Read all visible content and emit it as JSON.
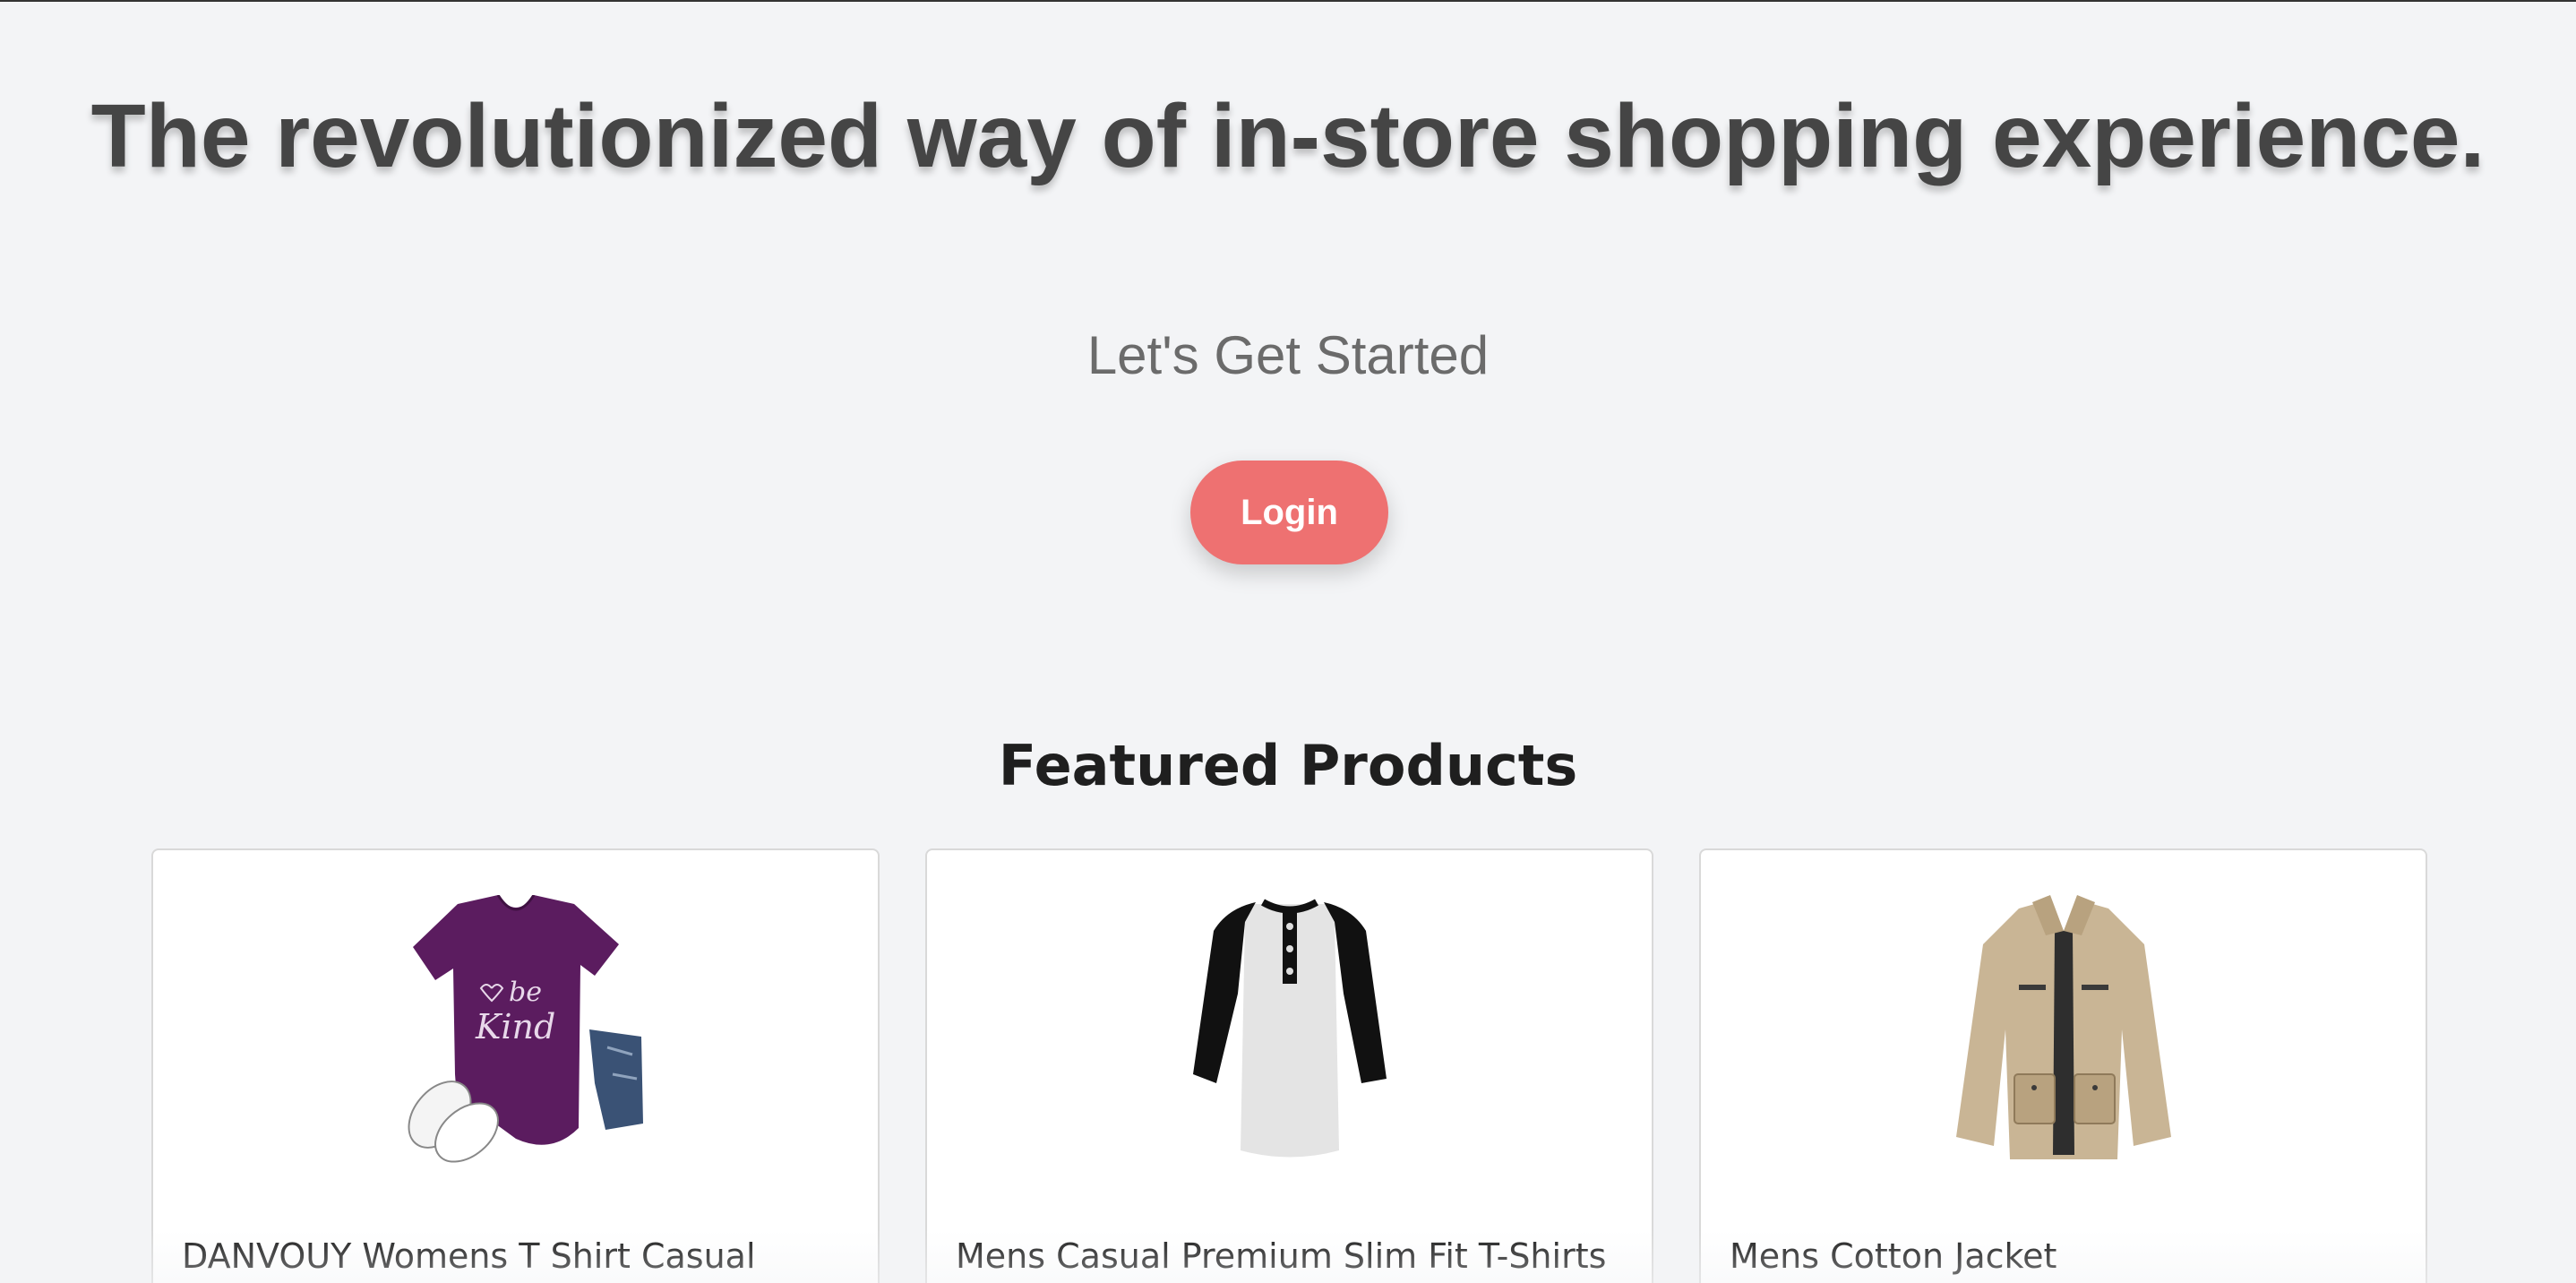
{
  "hero": {
    "title": "The revolutionized way of in-store shopping experience.",
    "subtitle": "Let's Get Started",
    "login_label": "Login"
  },
  "featured": {
    "heading": "Featured Products",
    "products": [
      {
        "title": "DANVOUY Womens T Shirt Casual",
        "image": "purple-be-kind-tshirt"
      },
      {
        "title": "Mens Casual Premium Slim Fit T-Shirts",
        "image": "raglan-henley-shirt"
      },
      {
        "title": "Mens Cotton Jacket",
        "image": "khaki-cotton-jacket"
      }
    ]
  },
  "colors": {
    "background": "#f3f4f6",
    "accent": "#ee7171",
    "title": "#454545"
  }
}
